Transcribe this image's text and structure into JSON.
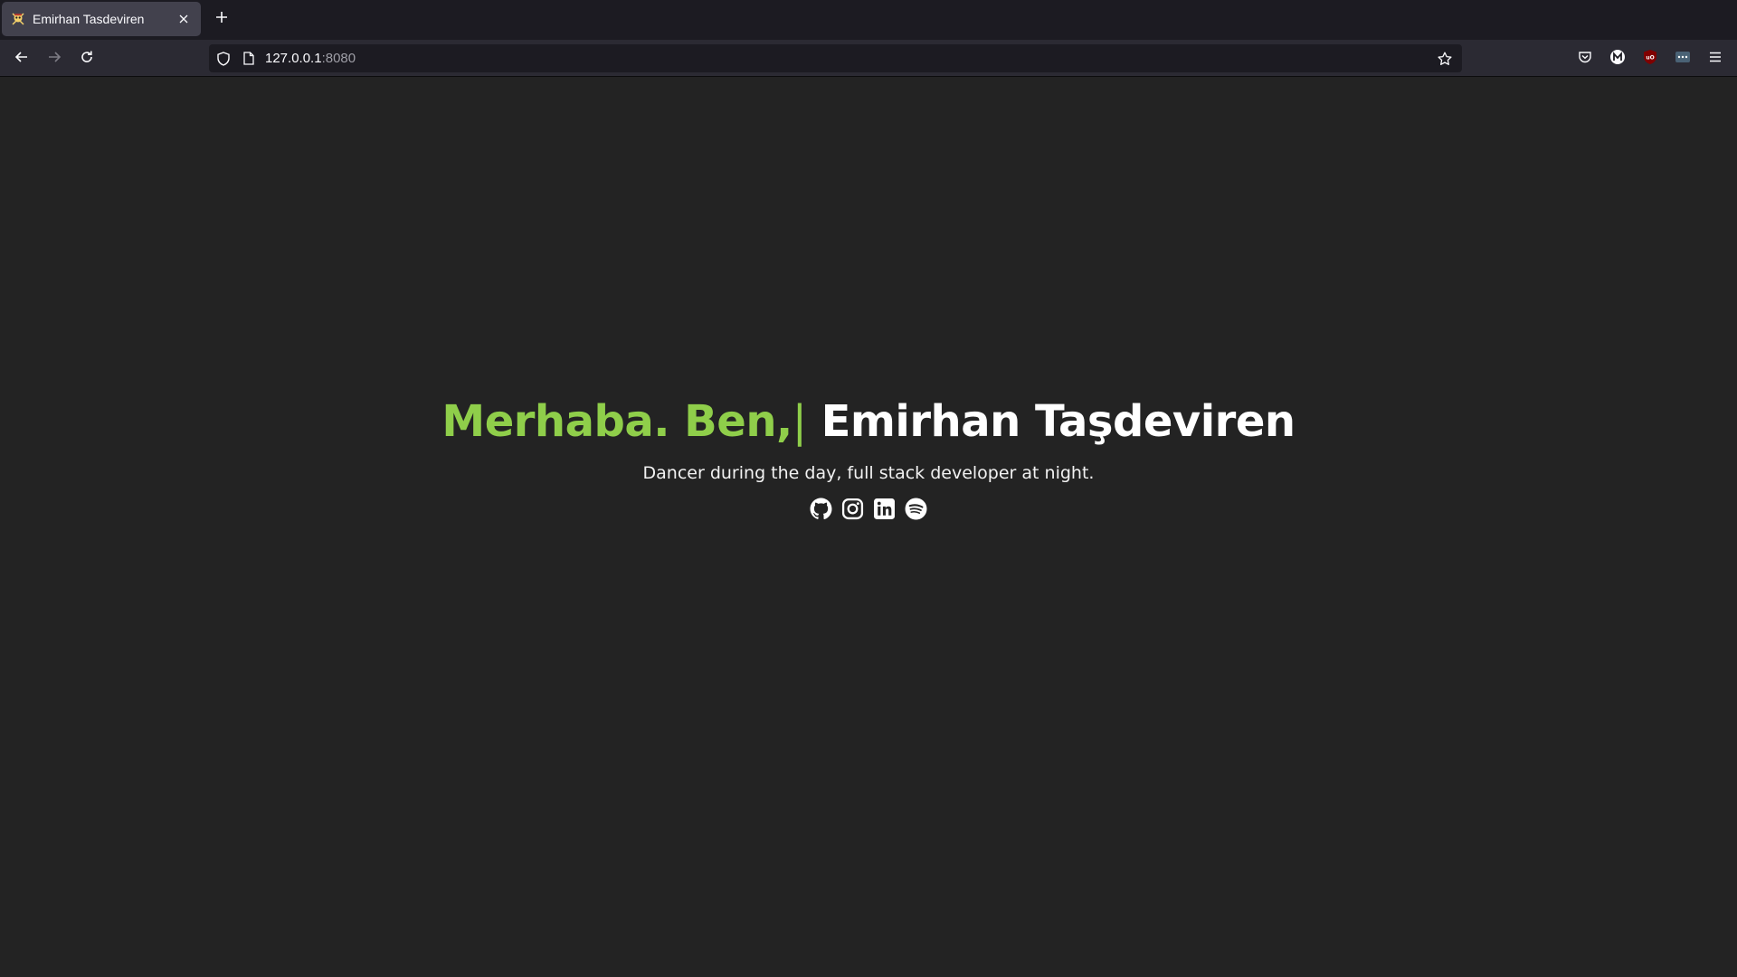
{
  "browser": {
    "tab": {
      "title": "Emirhan Tasdeviren",
      "favicon": "pirate-skull-icon",
      "close_icon": "close-icon"
    },
    "new_tab_icon": "plus-icon",
    "nav": {
      "back_icon": "arrow-left-icon",
      "forward_icon": "arrow-right-icon",
      "reload_icon": "reload-icon"
    },
    "url": {
      "host": "127.0.0.1",
      "port": ":8080",
      "security_icon": "shield-icon",
      "page_icon": "page-icon"
    },
    "toolbar_icons": [
      "pocket-icon",
      "m-extension-icon",
      "ublock-icon",
      "extension-icon",
      "menu-icon"
    ]
  },
  "hero": {
    "greeting": "Merhaba. Ben,",
    "cursor": "|",
    "name": "Emirhan Taşdeviren",
    "tagline": "Dancer during the day, full stack developer at night."
  },
  "socials": [
    {
      "name": "github",
      "icon": "github-icon"
    },
    {
      "name": "instagram",
      "icon": "instagram-icon"
    },
    {
      "name": "linkedin",
      "icon": "linkedin-icon"
    },
    {
      "name": "spotify",
      "icon": "spotify-icon"
    }
  ],
  "colors": {
    "accent": "#8fce4a",
    "page_background": "#232323",
    "text": "#ffffff"
  }
}
